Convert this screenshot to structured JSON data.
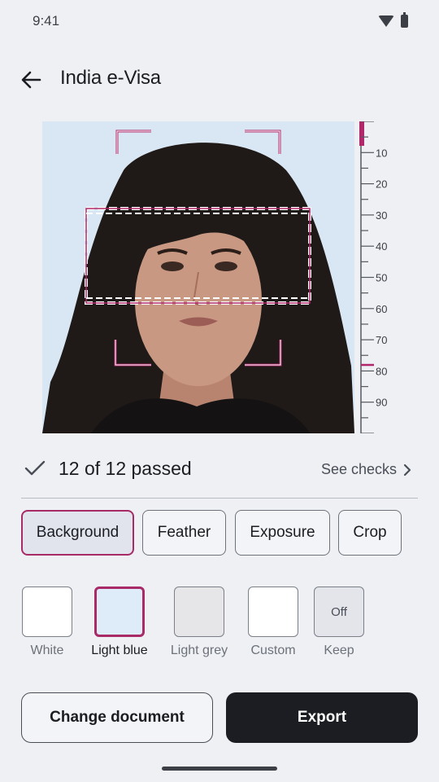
{
  "status": {
    "time": "9:41"
  },
  "appbar": {
    "title": "India e-Visa",
    "back_icon": "arrow-left-icon"
  },
  "ruler": {
    "ticks": [
      "10",
      "20",
      "30",
      "40",
      "50",
      "60",
      "70",
      "80",
      "90"
    ],
    "accent_color": "#b0286a"
  },
  "checks": {
    "summary": "12 of 12 passed",
    "see_checks": "See checks"
  },
  "tabs": [
    {
      "label": "Background",
      "active": true
    },
    {
      "label": "Feather",
      "active": false
    },
    {
      "label": "Exposure",
      "active": false
    },
    {
      "label": "Crop",
      "active": false
    }
  ],
  "swatches": [
    {
      "label": "White",
      "color": "#ffffff",
      "active": false,
      "text": ""
    },
    {
      "label": "Light blue",
      "color": "#deebf8",
      "active": true,
      "text": ""
    },
    {
      "label": "Light grey",
      "color": "#e6e6e8",
      "active": false,
      "text": ""
    },
    {
      "label": "Custom",
      "color": "#ffffff",
      "active": false,
      "text": ""
    },
    {
      "label": "Keep",
      "color": "#e3e5ea",
      "active": false,
      "text": "Off"
    }
  ],
  "actions": {
    "change_document": "Change document",
    "export": "Export"
  },
  "colors": {
    "accent": "#a82a66",
    "primary": "#1b1d22",
    "background": "#eef0f4"
  }
}
